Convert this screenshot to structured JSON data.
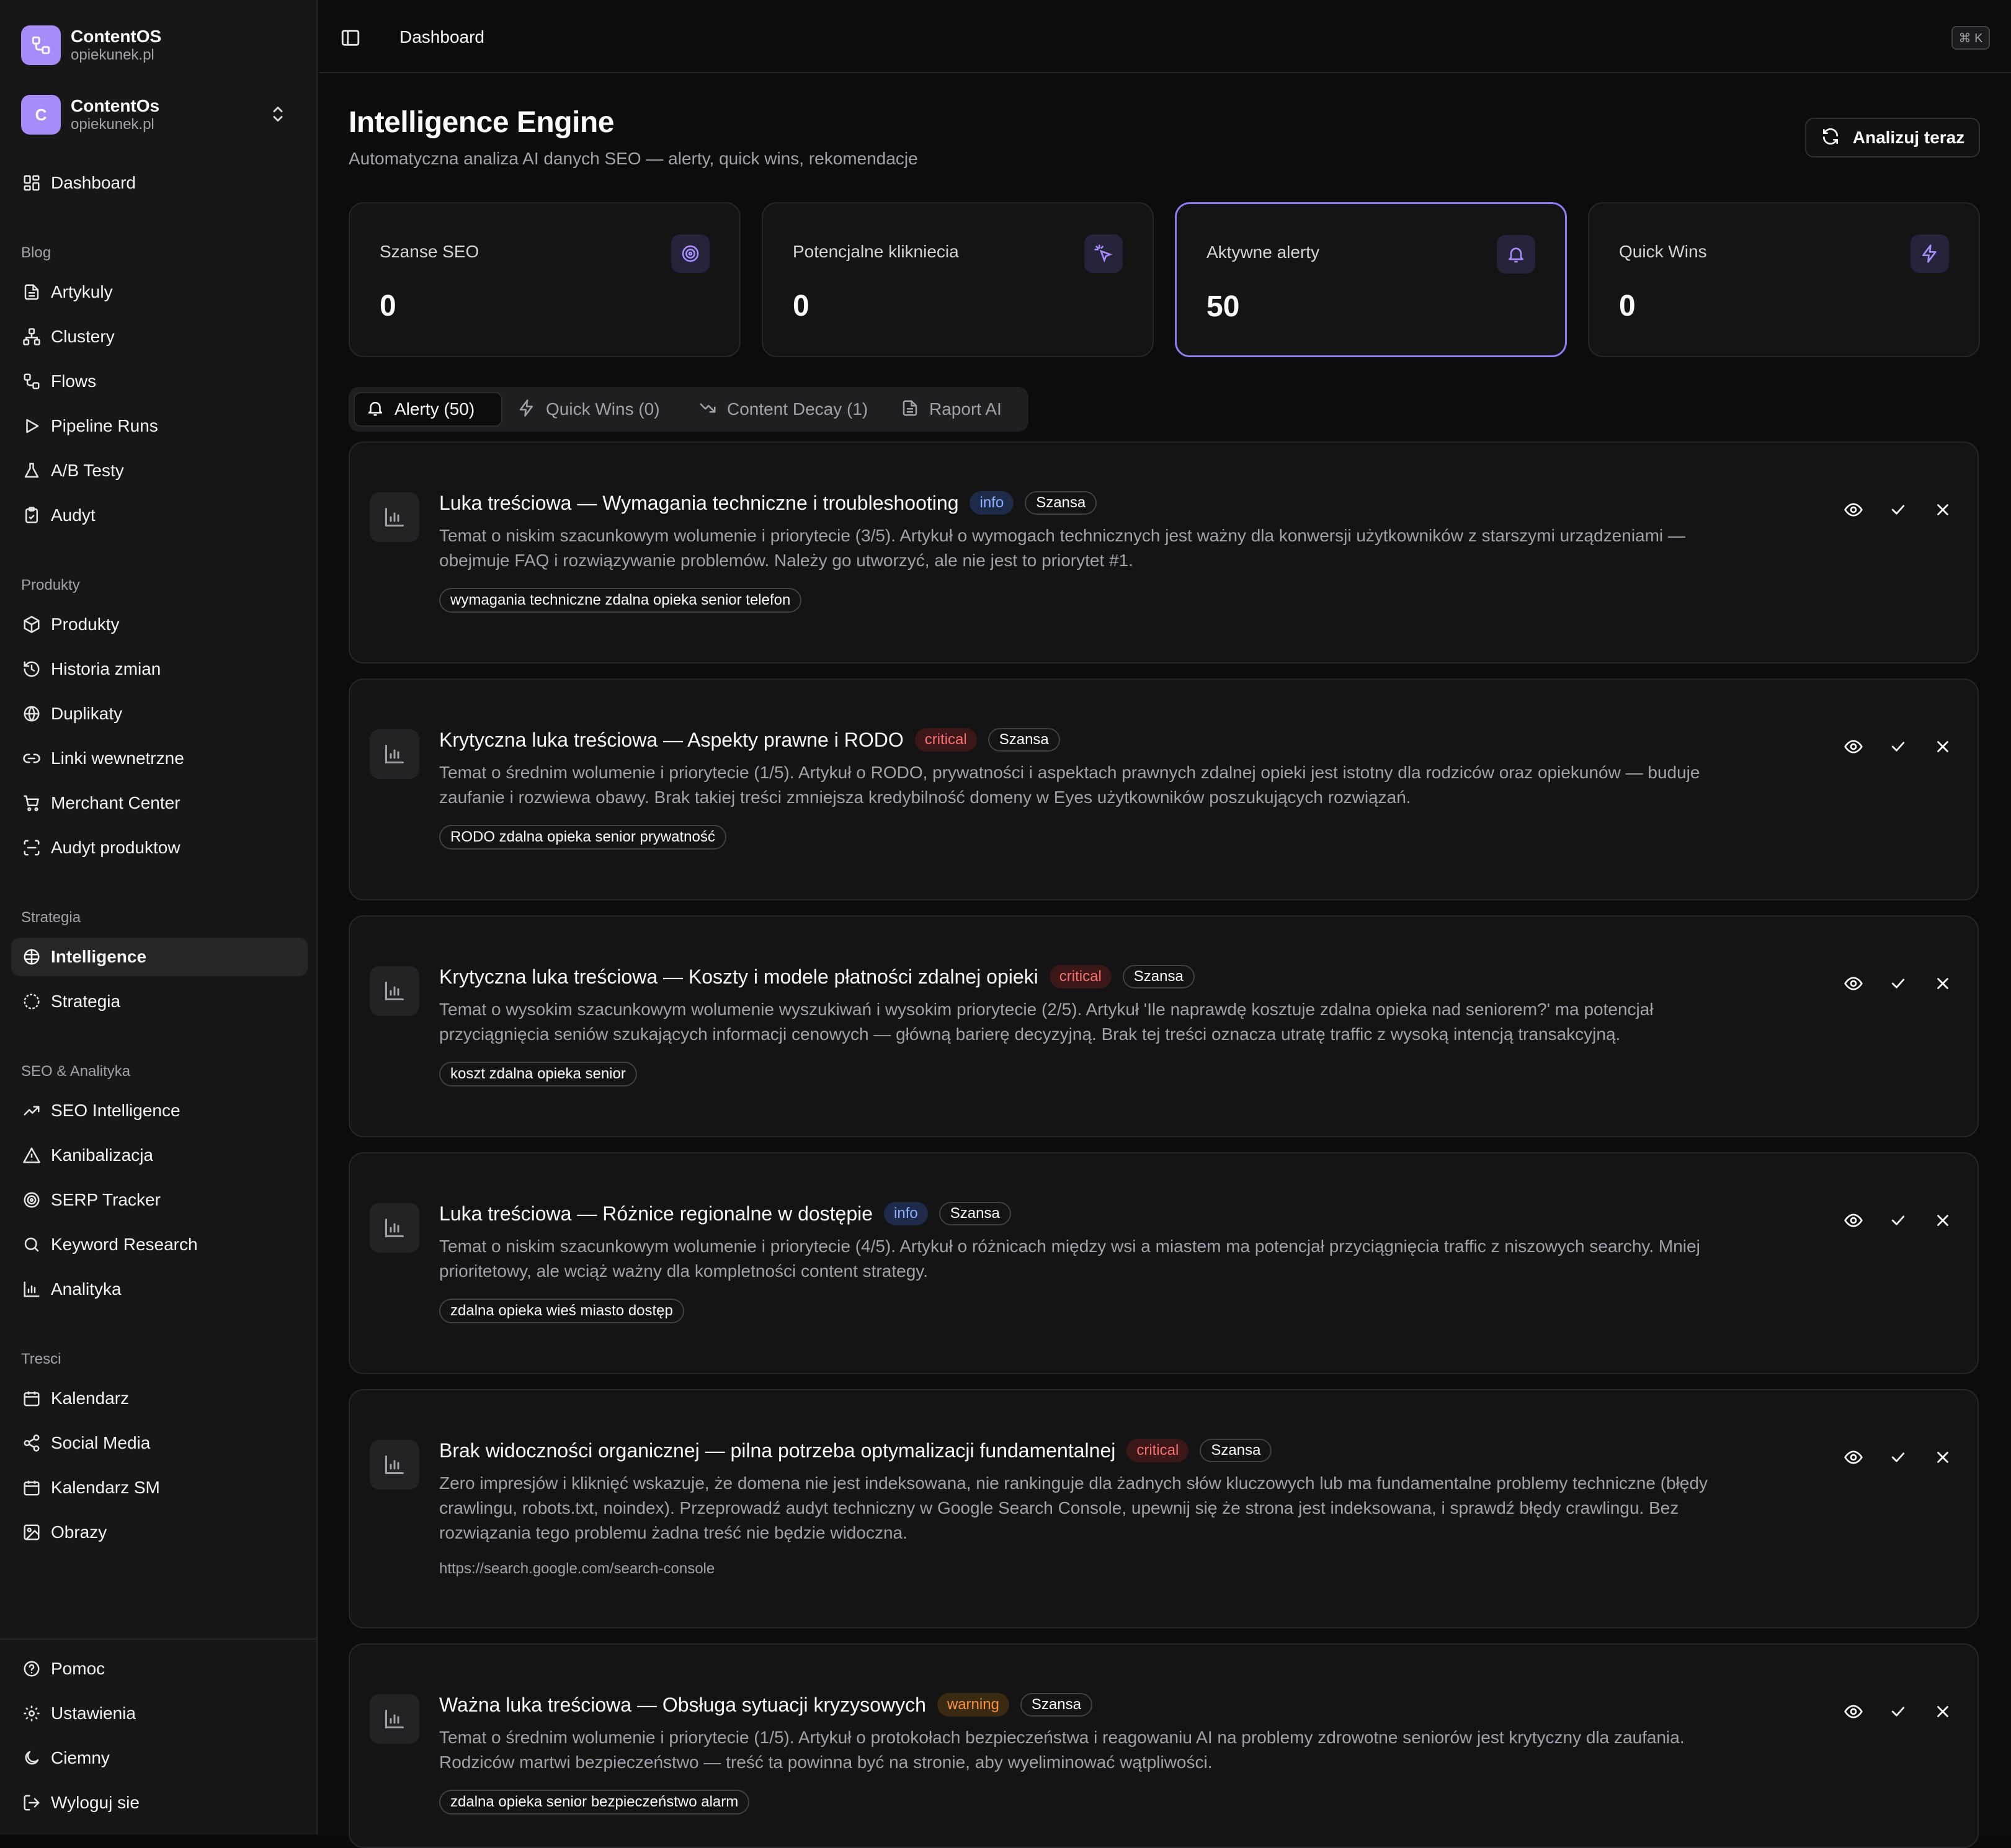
{
  "brand": {
    "name": "ContentOS",
    "domain": "opiekunek.pl"
  },
  "workspace": {
    "initial": "C",
    "name": "ContentOs",
    "domain": "opiekunek.pl"
  },
  "nav": {
    "dashboard": "Dashboard",
    "groups": {
      "blog": "Blog",
      "produkty": "Produkty",
      "strategia": "Strategia",
      "seo": "SEO & Analityka",
      "tresci": "Tresci"
    },
    "items": {
      "artykuly": "Artykuly",
      "clustery": "Clustery",
      "flows": "Flows",
      "pipeline_runs": "Pipeline Runs",
      "ab_testy": "A/B Testy",
      "audyt": "Audyt",
      "produkty": "Produkty",
      "historia_zmian": "Historia zmian",
      "duplikaty": "Duplikaty",
      "linki_wewnetrzne": "Linki wewnetrzne",
      "merchant_center": "Merchant Center",
      "audyt_produktow": "Audyt produktow",
      "intelligence": "Intelligence",
      "strategia": "Strategia",
      "seo_intelligence": "SEO Intelligence",
      "kanibalizacja": "Kanibalizacja",
      "serp_tracker": "SERP Tracker",
      "keyword_research": "Keyword Research",
      "analityka": "Analityka",
      "kalendarz": "Kalendarz",
      "social_media": "Social Media",
      "kalendarz_sm": "Kalendarz SM",
      "obrazy": "Obrazy"
    },
    "bottom": {
      "pomoc": "Pomoc",
      "ustawienia": "Ustawienia",
      "ciemny": "Ciemny",
      "wyloguj": "Wyloguj sie"
    }
  },
  "header": {
    "breadcrumb": "Dashboard",
    "shortcut": "⌘ K"
  },
  "page": {
    "title": "Intelligence Engine",
    "subtitle": "Automatyczna analiza AI danych SEO — alerty, quick wins, rekomendacje",
    "analyze_button": "Analizuj teraz"
  },
  "stats": [
    {
      "label": "Szanse SEO",
      "value": "0",
      "icon": "target-icon"
    },
    {
      "label": "Potencjalne klikniecia",
      "value": "0",
      "icon": "sparkle-click-icon"
    },
    {
      "label": "Aktywne alerty",
      "value": "50",
      "icon": "bell-icon"
    },
    {
      "label": "Quick Wins",
      "value": "0",
      "icon": "zap-icon"
    }
  ],
  "tabs": [
    {
      "label": "Alerty (50)"
    },
    {
      "label": "Quick Wins (0)"
    },
    {
      "label": "Content Decay (1)"
    },
    {
      "label": "Raport AI"
    }
  ],
  "alerts": [
    {
      "title": "Luka treściowa — Wymagania techniczne i troubleshooting",
      "severity": "info",
      "tag": "Szansa",
      "description": "Temat o niskim szacunkowym wolumenie i priorytecie (3/5). Artykuł o wymogach technicznych jest ważny dla konwersji użytkowników z starszymi urządzeniami — obejmuje FAQ i rozwiązywanie problemów. Należy go utworzyć, ale nie jest to priorytet #1.",
      "keyword": "wymagania techniczne zdalna opieka senior telefon"
    },
    {
      "title": "Krytyczna luka treściowa — Aspekty prawne i RODO",
      "severity": "critical",
      "tag": "Szansa",
      "description": "Temat o średnim wolumenie i priorytecie (1/5). Artykuł o RODO, prywatności i aspektach prawnych zdalnej opieki jest istotny dla rodziców oraz opiekunów — buduje zaufanie i rozwiewa obawy. Brak takiej treści zmniejsza kredybilność domeny w Eyes użytkowników poszukujących rozwiązań.",
      "keyword": "RODO zdalna opieka senior prywatność"
    },
    {
      "title": "Krytyczna luka treściowa — Koszty i modele płatności zdalnej opieki",
      "severity": "critical",
      "tag": "Szansa",
      "description": "Temat o wysokim szacunkowym wolumenie wyszukiwań i wysokim priorytecie (2/5). Artykuł 'Ile naprawdę kosztuje zdalna opieka nad seniorem?' ma potencjał przyciągnięcia seniów szukających informacji cenowych — główną barierę decyzyjną. Brak tej treści oznacza utratę traffic z wysoką intencją transakcyjną.",
      "keyword": "koszt zdalna opieka senior"
    },
    {
      "title": "Luka treściowa — Różnice regionalne w dostępie",
      "severity": "info",
      "tag": "Szansa",
      "description": "Temat o niskim szacunkowym wolumenie i priorytecie (4/5). Artykuł o różnicach między wsi a miastem ma potencjał przyciągnięcia traffic z niszowych searchy. Mniej prioritetowy, ale wciąż ważny dla kompletności content strategy.",
      "keyword": "zdalna opieka wieś miasto dostęp"
    },
    {
      "title": "Brak widoczności organicznej — pilna potrzeba optymalizacji fundamentalnej",
      "severity": "critical",
      "tag": "Szansa",
      "description": "Zero impresjów i kliknięć wskazuje, że domena nie jest indeksowana, nie rankinguje dla żadnych słów kluczowych lub ma fundamentalne problemy techniczne (błędy crawlingu, robots.txt, noindex). Przeprowadź audyt techniczny w Google Search Console, upewnij się że strona jest indeksowana, i sprawdź błędy crawlingu. Bez rozwiązania tego problemu żadna treść nie będzie widoczna.",
      "link": "https://search.google.com/search-console"
    },
    {
      "title": "Ważna luka treściowa — Obsługa sytuacji kryzysowych",
      "severity": "warning",
      "tag": "Szansa",
      "description": "Temat o średnim wolumenie i priorytecie (1/5). Artykuł o protokołach bezpieczeństwa i reagowaniu AI na problemy zdrowotne seniorów jest krytyczny dla zaufania. Rodziców martwi bezpieczeństwo — treść ta powinna być na stronie, aby wyeliminować wątpliwości.",
      "keyword": "zdalna opieka senior bezpieczeństwo alarm"
    }
  ],
  "colors": {
    "accent": "#8b7cf6",
    "info": "#8fb0ff",
    "critical": "#f87171",
    "warning": "#fb923c"
  }
}
